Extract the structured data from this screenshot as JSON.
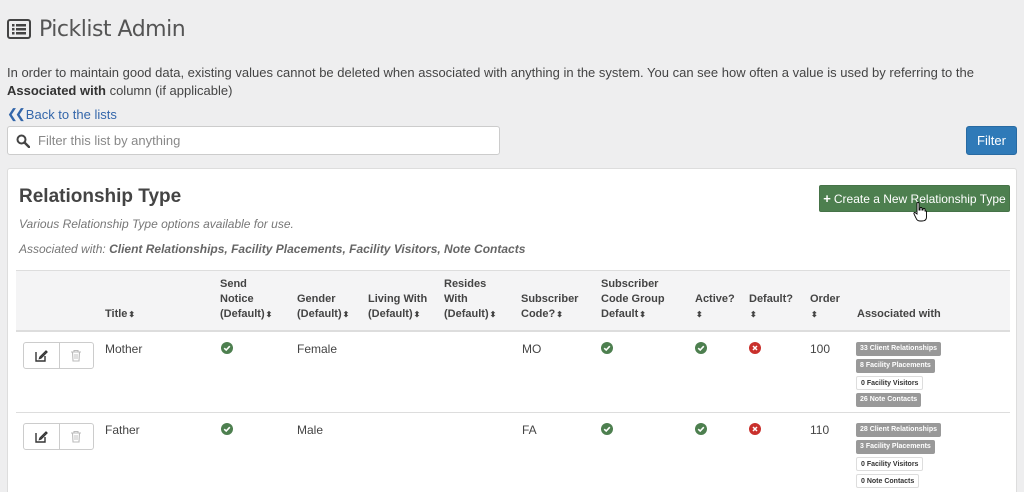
{
  "header": {
    "title": "Picklist Admin",
    "icon": "list-icon"
  },
  "intro": {
    "text": "In order to maintain good data, existing values cannot be deleted when associated with anything in the system. You can see how often a value is used by referring to the ",
    "bold": "Associated with",
    "suffix": " column (if applicable)"
  },
  "nav": {
    "back_label": "Back to the lists"
  },
  "search": {
    "placeholder": "Filter this list by anything",
    "value": ""
  },
  "filter_button": {
    "label": "Filter",
    "color": "#2f7ab8"
  },
  "card": {
    "title": "Relationship Type",
    "description": "Various Relationship Type options available for use.",
    "associated_prefix": "Associated with:",
    "associated_list": "Client Relationships, Facility Placements, Facility Visitors, Note Contacts",
    "create_button": "Create a New Relationship Type",
    "create_color": "#4d7f4f"
  },
  "table": {
    "columns": {
      "title": "Title",
      "send_notice": [
        "Send",
        "Notice",
        "(Default)"
      ],
      "gender": [
        "Gender",
        "(Default)"
      ],
      "living_with": [
        "Living With",
        "(Default)"
      ],
      "resides_with": [
        "Resides",
        "With",
        "(Default)"
      ],
      "subscriber_code": [
        "Subscriber",
        "Code?"
      ],
      "subscriber_code_group": [
        "Subscriber",
        "Code Group",
        "Default"
      ],
      "active": "Active?",
      "default": "Default?",
      "order": "Order",
      "associated_with": "Associated with"
    },
    "sort_glyph": "⬍",
    "rows": [
      {
        "title": "Mother",
        "send_notice": true,
        "gender": "Female",
        "subscriber_code": "MO",
        "subscriber_code_group": true,
        "active": true,
        "default": false,
        "order": "100",
        "badges": [
          {
            "label": "33 Client Relationships",
            "filled": true
          },
          {
            "label": "8 Facility Placements",
            "filled": true
          },
          {
            "label": "0 Facility Visitors",
            "filled": false
          },
          {
            "label": "26 Note Contacts",
            "filled": true
          }
        ]
      },
      {
        "title": "Father",
        "send_notice": true,
        "gender": "Male",
        "subscriber_code": "FA",
        "subscriber_code_group": true,
        "active": true,
        "default": false,
        "order": "110",
        "badges": [
          {
            "label": "28 Client Relationships",
            "filled": true
          },
          {
            "label": "3 Facility Placements",
            "filled": true
          },
          {
            "label": "0 Facility Visitors",
            "filled": false
          },
          {
            "label": "0 Note Contacts",
            "filled": false
          }
        ]
      }
    ]
  }
}
